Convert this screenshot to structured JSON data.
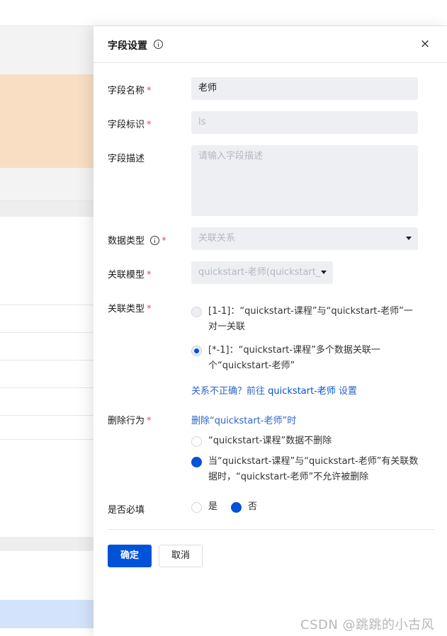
{
  "drawer": {
    "title": "字段设置",
    "close_label": "×"
  },
  "form": {
    "name": {
      "label": "字段名称",
      "value": "老师"
    },
    "identifier": {
      "label": "字段标识",
      "value": "ls"
    },
    "description": {
      "label": "字段描述",
      "placeholder": "请输入字段描述"
    },
    "data_type": {
      "label": "数据类型",
      "value": "关联关系"
    },
    "related_model": {
      "label": "关联模型",
      "value": "quickstart-老师(quickstart_"
    },
    "relation_type": {
      "label": "关联类型",
      "options": [
        {
          "line1": "[1-1]：“quickstart-课程”与“quickstart-老师”一",
          "line2": "对一关联",
          "selected": false
        },
        {
          "line1": "[*-1]：“quickstart-课程”多个数据关联一",
          "line2": "个“quickstart-老师”",
          "selected": true
        }
      ],
      "hint_prefix": "关系不正确？前往 ",
      "hint_link": "quickstart-老师",
      "hint_suffix": " 设置"
    },
    "delete_behavior": {
      "label": "删除行为",
      "subtitle": "删除“quickstart-老师”时",
      "options": [
        {
          "line1": "“quickstart-课程”数据不删除",
          "selected": false
        },
        {
          "line1": "当“quickstart-课程”与“quickstart-老师”有关联数",
          "line2": "据时，“quickstart-老师”不允许被删除",
          "selected": true
        }
      ]
    },
    "required": {
      "label": "是否必填",
      "yes": "是",
      "no": "否",
      "selected": "否"
    },
    "required_mark": "*"
  },
  "actions": {
    "confirm": "确定",
    "cancel": "取消"
  },
  "watermark": "CSDN @跳跳的小古风",
  "colors": {
    "primary": "#0052d9",
    "required": "#e34d59"
  }
}
